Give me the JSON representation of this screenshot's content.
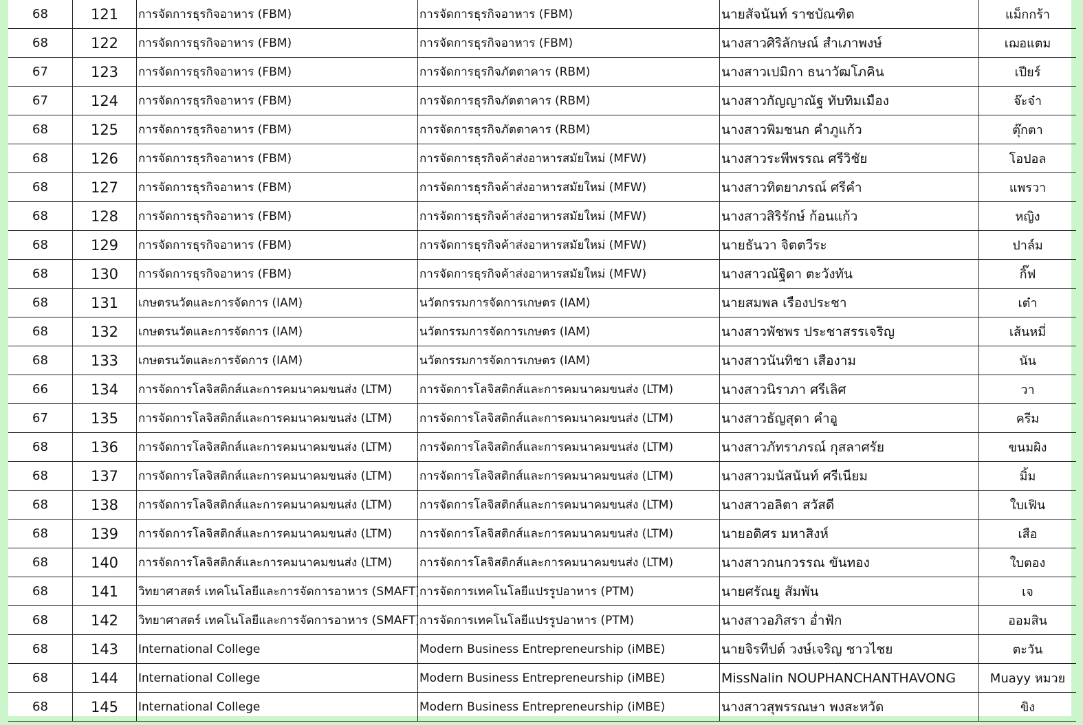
{
  "rows": [
    {
      "year": "68",
      "no": "121",
      "faculty": "การจัดการธุรกิจอาหาร (FBM)",
      "major": "การจัดการธุรกิจอาหาร (FBM)",
      "name": "นายสัจนันท์ ราชบัณฑิต",
      "nickname": "แม็กกร้า"
    },
    {
      "year": "68",
      "no": "122",
      "faculty": "การจัดการธุรกิจอาหาร (FBM)",
      "major": "การจัดการธุรกิจอาหาร (FBM)",
      "name": "นางสาวศิริลักษณ์ สำเภาพงษ์",
      "nickname": "เฌอแตม"
    },
    {
      "year": "67",
      "no": "123",
      "faculty": "การจัดการธุรกิจอาหาร (FBM)",
      "major": "การจัดการธุรกิจภัตตาคาร (RBM)",
      "name": "นางสาวเปมิกา ธนาวัฒโภคิน",
      "nickname": "เปียร์"
    },
    {
      "year": "67",
      "no": "124",
      "faculty": "การจัดการธุรกิจอาหาร (FBM)",
      "major": "การจัดการธุรกิจภัตตาคาร (RBM)",
      "name": "นางสาวกัญญาณัฐ ทับทิมเมือง",
      "nickname": "จ๊ะจ๋า"
    },
    {
      "year": "68",
      "no": "125",
      "faculty": "การจัดการธุรกิจอาหาร (FBM)",
      "major": "การจัดการธุรกิจภัตตาคาร (RBM)",
      "name": "นางสาวพิมชนก คำภูแก้ว",
      "nickname": "ตุ๊กตา"
    },
    {
      "year": "68",
      "no": "126",
      "faculty": "การจัดการธุรกิจอาหาร (FBM)",
      "major": "การจัดการธุรกิจค้าส่งอาหารสมัยใหม่ (MFW)",
      "name": "นางสาวระพีพรรณ ศรีวิชัย",
      "nickname": "โอปอล"
    },
    {
      "year": "68",
      "no": "127",
      "faculty": "การจัดการธุรกิจอาหาร (FBM)",
      "major": "การจัดการธุรกิจค้าส่งอาหารสมัยใหม่ (MFW)",
      "name": "นางสาวทิตยาภรณ์ ศรีคำ",
      "nickname": "แพรวา"
    },
    {
      "year": "68",
      "no": "128",
      "faculty": "การจัดการธุรกิจอาหาร (FBM)",
      "major": "การจัดการธุรกิจค้าส่งอาหารสมัยใหม่ (MFW)",
      "name": "นางสาวสิริรักษ์ ก้อนแก้ว",
      "nickname": "หญิง"
    },
    {
      "year": "68",
      "no": "129",
      "faculty": "การจัดการธุรกิจอาหาร (FBM)",
      "major": "การจัดการธุรกิจค้าส่งอาหารสมัยใหม่ (MFW)",
      "name": "นายธันวา จิตตวีระ",
      "nickname": "ปาล์ม"
    },
    {
      "year": "68",
      "no": "130",
      "faculty": "การจัดการธุรกิจอาหาร (FBM)",
      "major": "การจัดการธุรกิจค้าส่งอาหารสมัยใหม่ (MFW)",
      "name": "นางสาวณัฐิดา ตะวังทัน",
      "nickname": "กิ๊ฟ"
    },
    {
      "year": "68",
      "no": "131",
      "faculty": "เกษตรนวัตและการจัดการ (IAM)",
      "major": "นวัตกรรมการจัดการเกษตร (IAM)",
      "name": "นายสมพล เรืองประชา",
      "nickname": "เต๋า"
    },
    {
      "year": "68",
      "no": "132",
      "faculty": "เกษตรนวัตและการจัดการ (IAM)",
      "major": "นวัตกรรมการจัดการเกษตร (IAM)",
      "name": "นางสาวพัชพร ประชาสรรเจริญ",
      "nickname": "เส้นหมี่"
    },
    {
      "year": "68",
      "no": "133",
      "faculty": "เกษตรนวัตและการจัดการ (IAM)",
      "major": "นวัตกรรมการจัดการเกษตร (IAM)",
      "name": "นางสาวนันทิชา เสืองาม",
      "nickname": "นัน"
    },
    {
      "year": "66",
      "no": "134",
      "faculty": "การจัดการโลจิสติกส์และการคมนาคมขนส่ง (LTM)",
      "major": "การจัดการโลจิสติกส์และการคมนาคมขนส่ง (LTM)",
      "name": "นางสาวนิราภา ศรีเลิศ",
      "nickname": "วา"
    },
    {
      "year": "67",
      "no": "135",
      "faculty": "การจัดการโลจิสติกส์และการคมนาคมขนส่ง (LTM)",
      "major": "การจัดการโลจิสติกส์และการคมนาคมขนส่ง (LTM)",
      "name": "นางสาวธัญสุดา คำอู",
      "nickname": "ครีม"
    },
    {
      "year": "68",
      "no": "136",
      "faculty": "การจัดการโลจิสติกส์และการคมนาคมขนส่ง (LTM)",
      "major": "การจัดการโลจิสติกส์และการคมนาคมขนส่ง (LTM)",
      "name": "นางสาวภัทราภรณ์ กุสลาศรัย",
      "nickname": "ขนมผิง"
    },
    {
      "year": "68",
      "no": "137",
      "faculty": "การจัดการโลจิสติกส์และการคมนาคมขนส่ง (LTM)",
      "major": "การจัดการโลจิสติกส์และการคมนาคมขนส่ง (LTM)",
      "name": "นางสาวมนัสนันท์ ศรีเนียม",
      "nickname": "มิ้ม"
    },
    {
      "year": "68",
      "no": "138",
      "faculty": "การจัดการโลจิสติกส์และการคมนาคมขนส่ง (LTM)",
      "major": "การจัดการโลจิสติกส์และการคมนาคมขนส่ง (LTM)",
      "name": "นางสาวอลิตา สวัสดี",
      "nickname": "ใบเฟิน"
    },
    {
      "year": "68",
      "no": "139",
      "faculty": "การจัดการโลจิสติกส์และการคมนาคมขนส่ง (LTM)",
      "major": "การจัดการโลจิสติกส์และการคมนาคมขนส่ง (LTM)",
      "name": "นายอดิศร มหาสิงห์",
      "nickname": "เสือ"
    },
    {
      "year": "68",
      "no": "140",
      "faculty": "การจัดการโลจิสติกส์และการคมนาคมขนส่ง (LTM)",
      "major": "การจัดการโลจิสติกส์และการคมนาคมขนส่ง (LTM)",
      "name": "นางสาวกนกวรรณ ขันทอง",
      "nickname": "ใบตอง"
    },
    {
      "year": "68",
      "no": "141",
      "faculty": "วิทยาศาสตร์ เทคโนโลยีและการจัดการอาหาร (SMAFT)",
      "major": "การจัดการเทคโนโลยีแปรรูปอาหาร (PTM)",
      "name": "นายศรัณยู สัมพัน",
      "nickname": "เจ"
    },
    {
      "year": "68",
      "no": "142",
      "faculty": "วิทยาศาสตร์ เทคโนโลยีและการจัดการอาหาร (SMAFT)",
      "major": "การจัดการเทคโนโลยีแปรรูปอาหาร (PTM)",
      "name": "นางสาวอภิสรา อ่ำฟัก",
      "nickname": "ออมสิน"
    },
    {
      "year": "68",
      "no": "143",
      "faculty": "International College",
      "major": "Modern Business Entrepreneurship (iMBE)",
      "name": "นายจิรทีปต์ วงษ์เจริญ ชาวไชย",
      "nickname": "ตะวัน"
    },
    {
      "year": "68",
      "no": "144",
      "faculty": "International College",
      "major": "Modern Business Entrepreneurship (iMBE)",
      "name": "MissNalin NOUPHANCHANTHAVONG",
      "nickname": "Muayy หมวย"
    },
    {
      "year": "68",
      "no": "145",
      "faculty": "International College",
      "major": "Modern Business Entrepreneurship (iMBE)",
      "name": "นางสาวสุพรรณษา พงสะหวัด",
      "nickname": "ขิง"
    }
  ]
}
